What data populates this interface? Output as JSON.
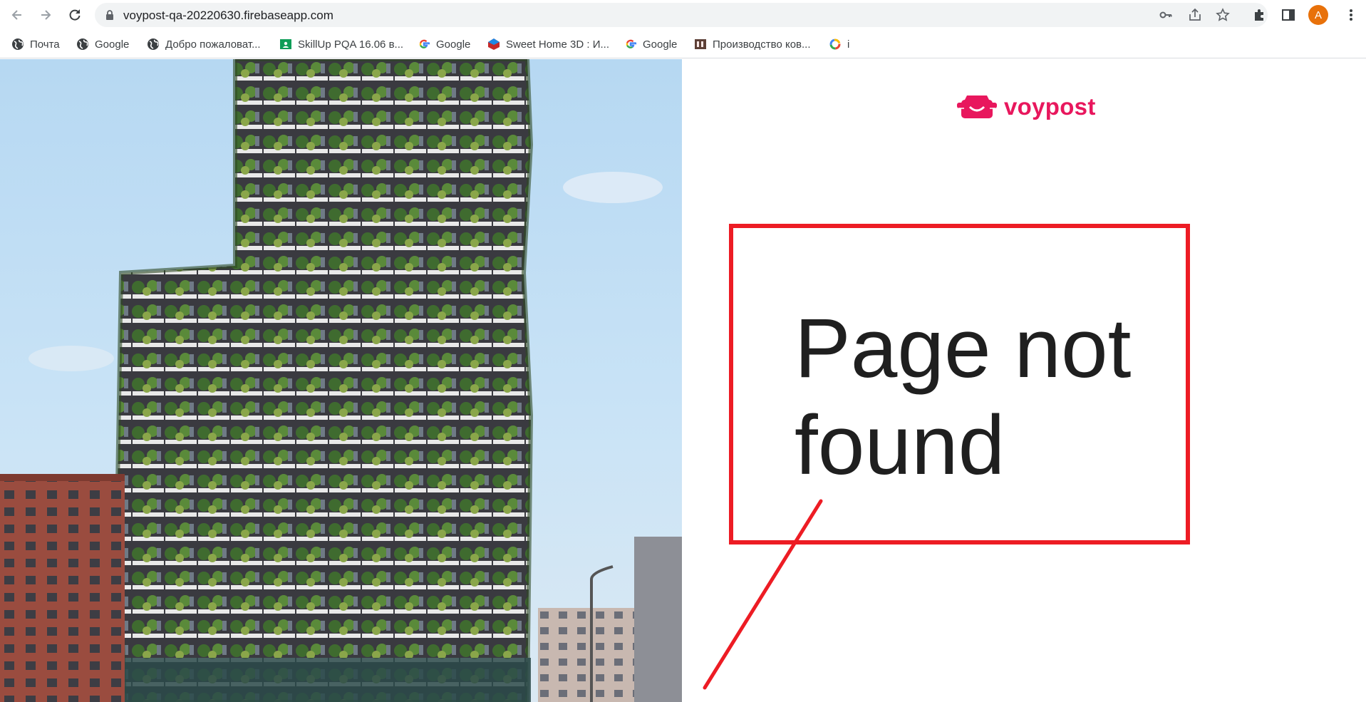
{
  "browser": {
    "url": "voypost-qa-20220630.firebaseapp.com",
    "profile_initial": "A",
    "accent_color": "#e8710a"
  },
  "bookmarks": [
    {
      "label": "Почта",
      "icon": "globe-icon"
    },
    {
      "label": "Google",
      "icon": "globe-icon"
    },
    {
      "label": "Добро пожаловат...",
      "icon": "globe-icon"
    },
    {
      "label": "SkillUp PQA 16.06 в...",
      "icon": "classroom-icon"
    },
    {
      "label": "Google",
      "icon": "google-icon"
    },
    {
      "label": "Sweet Home 3D : И...",
      "icon": "sweethome-icon"
    },
    {
      "label": "Google",
      "icon": "google-icon"
    },
    {
      "label": "Производство ков...",
      "icon": "site-icon"
    },
    {
      "label": "i",
      "icon": "ring-icon"
    }
  ],
  "page": {
    "brand_name": "voypost",
    "brand_color": "#e8175d",
    "message": "Page not found",
    "annotation_color": "#ed1c24"
  }
}
